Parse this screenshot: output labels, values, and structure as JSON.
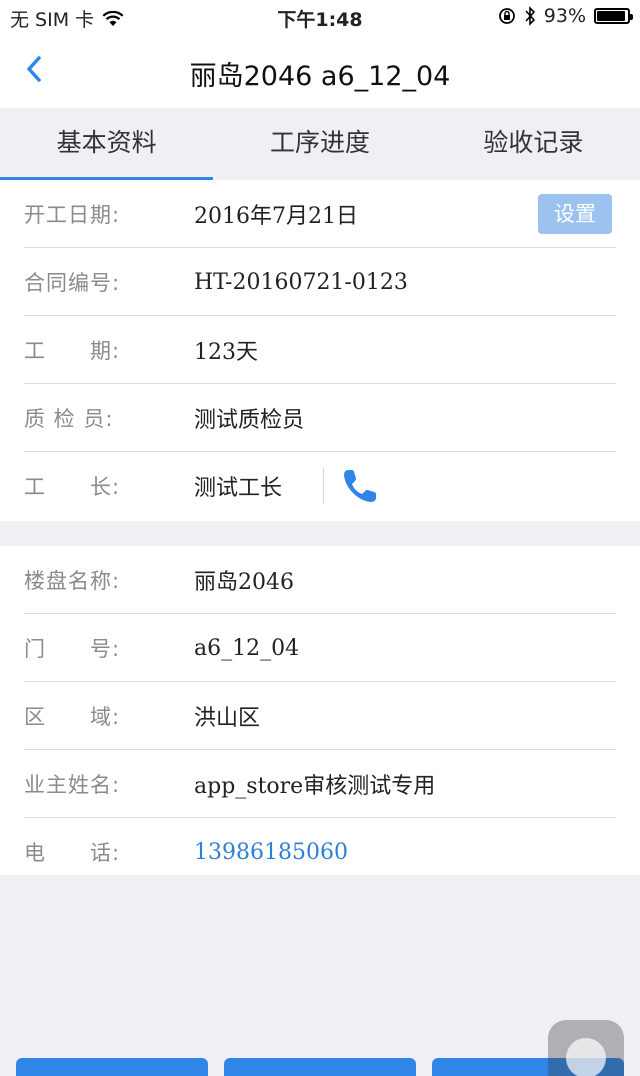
{
  "status_bar": {
    "carrier": "无 SIM 卡",
    "time": "下午1:48",
    "battery": "93%",
    "battery_level": 0.93
  },
  "nav": {
    "title": "丽岛2046 a6_12_04"
  },
  "tabs": [
    {
      "label": "基本资料",
      "active": true
    },
    {
      "label": "工序进度",
      "active": false
    },
    {
      "label": "验收记录",
      "active": false
    }
  ],
  "section1": {
    "start_date_label": "开工日期:",
    "start_date_value": "2016年7月21日",
    "settings_button": "设置",
    "contract_label": "合同编号:",
    "contract_value": "HT-20160721-0123",
    "period_label": "工　　期:",
    "period_value": "123天",
    "inspector_label": "质 检 员:",
    "inspector_value": "测试质检员",
    "foreman_label": "工　　长:",
    "foreman_value": "测试工长"
  },
  "section2": {
    "building_label": "楼盘名称:",
    "building_value": "丽岛2046",
    "door_label": "门　　号:",
    "door_value": "a6_12_04",
    "area_label": "区　　域:",
    "area_value": "洪山区",
    "owner_label": "业主姓名:",
    "owner_value": "app_store审核测试专用",
    "phone_label": "电　　话:",
    "phone_value": "13986185060"
  },
  "colors": {
    "accent": "#2f86e8",
    "button_disabled": "#9cc3f0",
    "link": "#2f7fd8"
  },
  "icons": [
    "wifi-icon",
    "lock-rotation-icon",
    "bluetooth-icon",
    "battery-icon",
    "back-chevron-icon",
    "phone-icon"
  ]
}
